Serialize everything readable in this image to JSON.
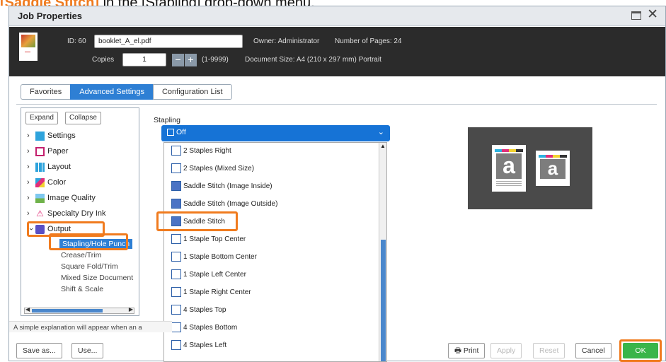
{
  "caption": {
    "highlight": "[Saddle Stitch]",
    "text": " in the [Stapling] drop-down menu."
  },
  "window": {
    "title": "Job Properties"
  },
  "info": {
    "id_label": "ID: 60",
    "filename": "booklet_A_el.pdf",
    "owner": "Owner: Administrator",
    "pages": "Number of Pages: 24",
    "copies_label": "Copies",
    "copies_value": "1",
    "copies_range": "(1-9999)",
    "doc_size": "Document Size: A4 (210 x 297 mm) Portrait"
  },
  "tabs": [
    {
      "label": "Favorites"
    },
    {
      "label": "Advanced Settings",
      "active": true
    },
    {
      "label": "Configuration List"
    }
  ],
  "tree": {
    "expand": "Expand",
    "collapse": "Collapse",
    "items": [
      {
        "label": "Settings",
        "icon": "settings-icon"
      },
      {
        "label": "Paper",
        "icon": "paper-icon"
      },
      {
        "label": "Layout",
        "icon": "layout-icon"
      },
      {
        "label": "Color",
        "icon": "color-icon"
      },
      {
        "label": "Image Quality",
        "icon": "image-quality-icon"
      },
      {
        "label": "Specialty Dry Ink",
        "icon": "specialty-dry-ink-icon"
      },
      {
        "label": "Output",
        "icon": "output-icon"
      }
    ],
    "output_children": [
      "Stapling/Hole Punch",
      "Crease/Trim",
      "Square Fold/Trim",
      "Mixed Size Document",
      "Shift & Scale"
    ]
  },
  "stapling": {
    "label": "Stapling",
    "selected": "Off",
    "options": [
      "2 Staples Right",
      "2 Staples (Mixed Size)",
      "Saddle Stitch (Image Inside)",
      "Saddle Stitch (Image Outside)",
      "Saddle Stitch",
      "1 Staple Top Center",
      "1 Staple Bottom Center",
      "1 Staple Left Center",
      "1 Staple Right Center",
      "4 Staples Top",
      "4 Staples Bottom",
      "4 Staples Left"
    ]
  },
  "preview": {
    "letter": "a"
  },
  "status": "A simple explanation will appear when an a",
  "buttons": {
    "save_as": "Save as...",
    "use": "Use...",
    "print": "Print",
    "apply": "Apply",
    "reset": "Reset",
    "cancel": "Cancel",
    "ok": "OK"
  },
  "colors": {
    "accent": "#2e7fd4",
    "highlight": "#f07b1e",
    "ok": "#39b54a"
  }
}
